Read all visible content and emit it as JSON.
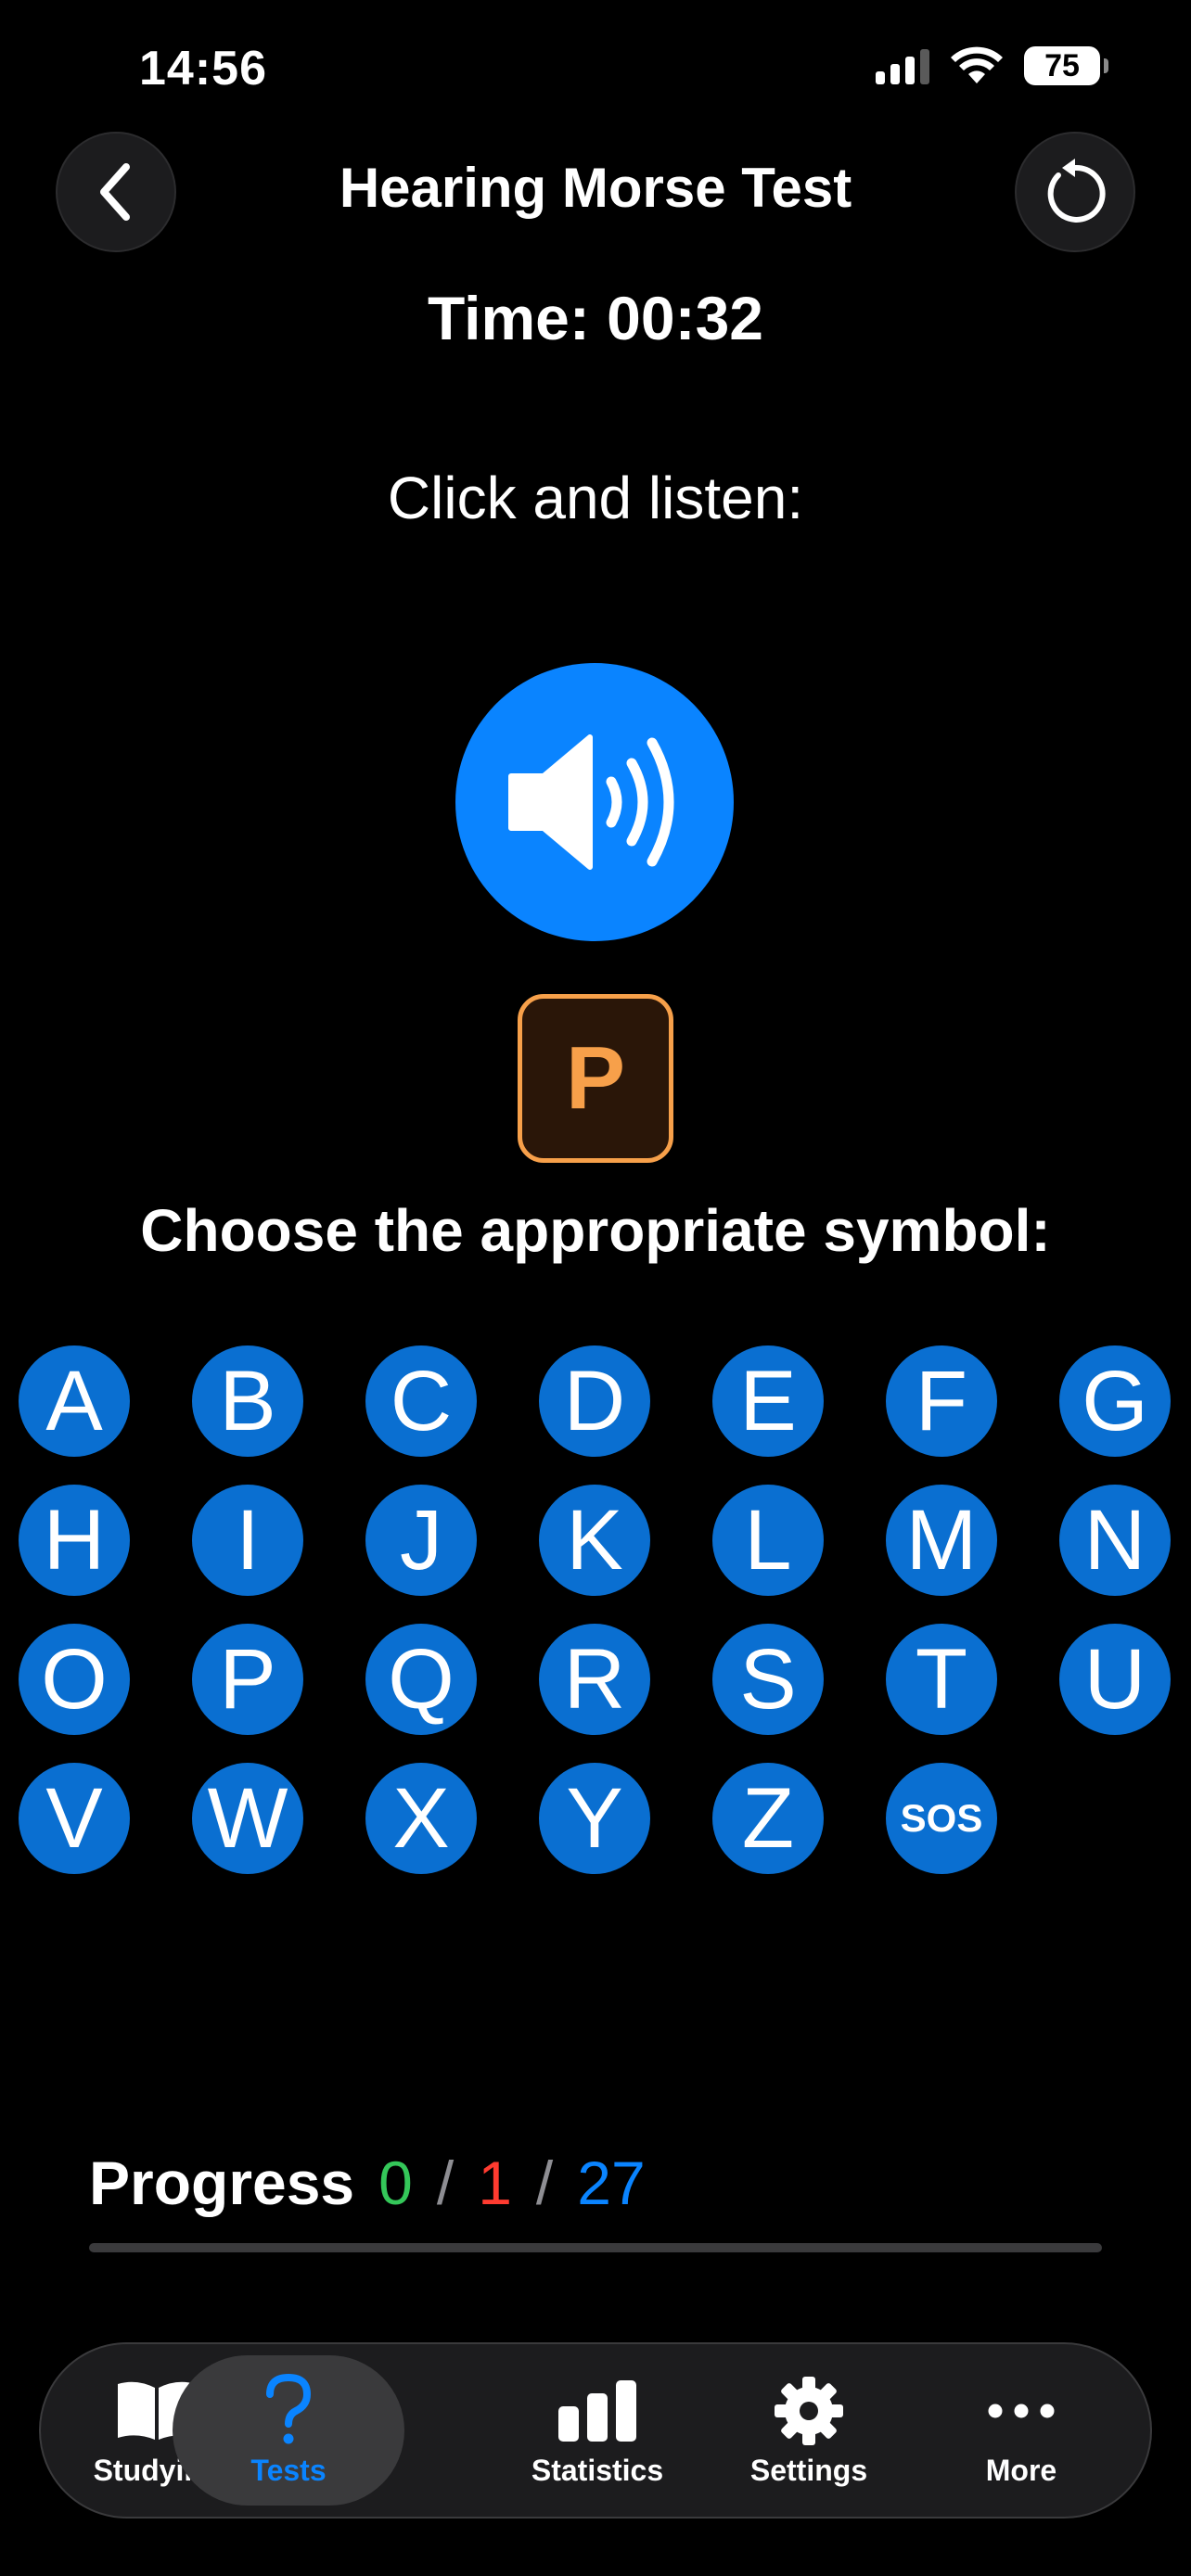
{
  "status_bar": {
    "time": "14:56",
    "battery": "75"
  },
  "header": {
    "title": "Hearing Morse Test"
  },
  "timer": {
    "label": "Time: 00:32"
  },
  "instruction": "Click and listen:",
  "answer": {
    "letter": "P"
  },
  "choose_prompt": "Choose the appropriate symbol:",
  "letters": [
    "A",
    "B",
    "C",
    "D",
    "E",
    "F",
    "G",
    "H",
    "I",
    "J",
    "K",
    "L",
    "M",
    "N",
    "O",
    "P",
    "Q",
    "R",
    "S",
    "T",
    "U",
    "V",
    "W",
    "X",
    "Y",
    "Z",
    "SOS"
  ],
  "progress": {
    "label": "Progress",
    "correct": "0",
    "wrong": "1",
    "total": "27",
    "separator": "/",
    "fraction": 0.0
  },
  "tabs": [
    {
      "label": "Studying",
      "icon": "book-icon",
      "active": false
    },
    {
      "label": "Tests",
      "icon": "question-mark-icon",
      "active": true
    },
    {
      "label": "Statistics",
      "icon": "bar-chart-icon",
      "active": false
    },
    {
      "label": "Settings",
      "icon": "gear-icon",
      "active": false
    },
    {
      "label": "More",
      "icon": "ellipsis-icon",
      "active": false
    }
  ],
  "colors": {
    "accent": "#0a84ff",
    "letter_button": "#0a6fd1",
    "answer_orange": "#f7a04a",
    "correct_green": "#34c759",
    "wrong_red": "#ff3b30"
  }
}
